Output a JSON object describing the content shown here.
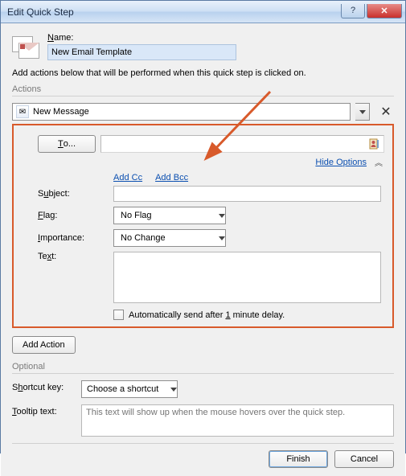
{
  "window": {
    "title": "Edit Quick Step"
  },
  "name": {
    "label_pre": "N",
    "label_post": "ame:",
    "value": "New Email Template"
  },
  "description": "Add actions below that will be performed when this quick step is clicked on.",
  "actions": {
    "heading": "Actions",
    "combo_label": "New Message",
    "combo_icon_glyph": "✉",
    "delete_glyph": "✕"
  },
  "message": {
    "to_btn_pre": "T",
    "to_btn_post": "o...",
    "hide_options": "Hide Options",
    "chevrons": "︽",
    "add_cc_pre": "Add ",
    "add_cc_u": "C",
    "add_cc_post": "c",
    "add_bcc_pre": "Add ",
    "add_bcc_u": "B",
    "add_bcc_post": "cc",
    "subject_pre": "S",
    "subject_u": "u",
    "subject_post": "bject:",
    "flag_u": "F",
    "flag_post": "lag:",
    "flag_value": "No Flag",
    "importance_u": "I",
    "importance_post": "mportance:",
    "importance_value": "No Change",
    "text_label": "Te",
    "text_u": "x",
    "text_post": "t:",
    "auto_send_pre": "Automatically send after ",
    "auto_send_u": "1",
    "auto_send_post": " minute delay."
  },
  "add_action_btn": "Add Action",
  "optional": {
    "heading": "Optional",
    "shortcut_pre": "S",
    "shortcut_u": "h",
    "shortcut_post": "ortcut key:",
    "shortcut_value": "Choose a shortcut",
    "tooltip_label": "Tooltip text:",
    "tooltip_u_char": "T",
    "tooltip_placeholder": "This text will show up when the mouse hovers over the quick step."
  },
  "buttons": {
    "finish": "Finish",
    "cancel": "Cancel"
  }
}
